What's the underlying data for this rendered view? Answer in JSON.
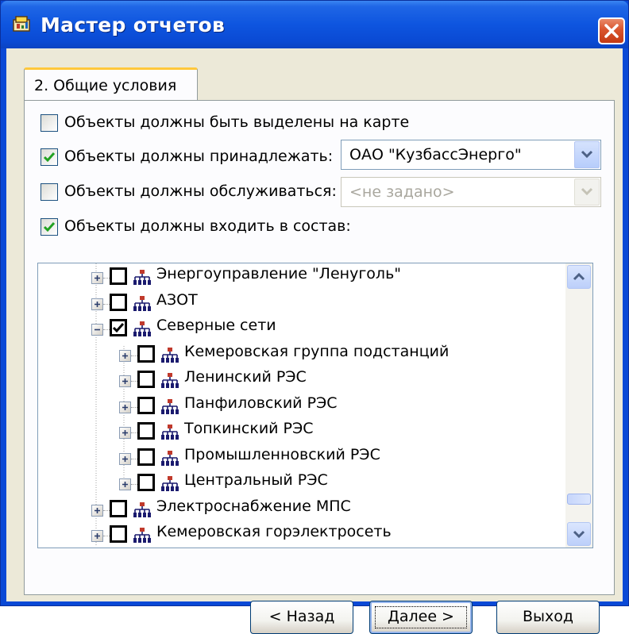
{
  "window": {
    "title": "Мастер отчетов"
  },
  "tab": {
    "label": "2. Общие условия"
  },
  "options": [
    {
      "label": "Объекты должны быть выделены на карте",
      "checked": false
    },
    {
      "label": "Объекты должны принадлежать:",
      "checked": true
    },
    {
      "label": "Объекты должны обслуживаться:",
      "checked": false
    },
    {
      "label": "Объекты должны входить в состав:",
      "checked": true
    }
  ],
  "owner_combo": {
    "value": "ОАО \"КузбассЭнерго\"",
    "enabled": true
  },
  "service_combo": {
    "value": "<не задано>",
    "enabled": false
  },
  "tree": {
    "items": [
      {
        "label": "Энергоуправление \"Ленуголь\"",
        "level": 0,
        "expanded": false,
        "checked": false
      },
      {
        "label": "АЗОТ",
        "level": 0,
        "expanded": false,
        "checked": false
      },
      {
        "label": "Северные сети",
        "level": 0,
        "expanded": true,
        "checked": true
      },
      {
        "label": "Кемеровская группа подстанций",
        "level": 1,
        "expanded": false,
        "checked": false
      },
      {
        "label": "Ленинский РЭС",
        "level": 1,
        "expanded": false,
        "checked": false
      },
      {
        "label": "Панфиловский РЭС",
        "level": 1,
        "expanded": false,
        "checked": false
      },
      {
        "label": "Топкинский РЭС",
        "level": 1,
        "expanded": false,
        "checked": false
      },
      {
        "label": "Промышленновский РЭС",
        "level": 1,
        "expanded": false,
        "checked": false
      },
      {
        "label": "Центральный РЭС",
        "level": 1,
        "expanded": false,
        "checked": false
      },
      {
        "label": "Электроснабжение МПС",
        "level": 0,
        "expanded": false,
        "checked": false
      },
      {
        "label": "Кемеровская горэлектросеть",
        "level": 0,
        "expanded": false,
        "checked": false
      }
    ]
  },
  "buttons": {
    "back": "< Назад",
    "next": "Далее >",
    "exit": "Выход"
  },
  "icons": {
    "app": "report-wizard-icon",
    "close": "close-icon",
    "node": "org-structure-icon"
  },
  "colors": {
    "titlebar": "#0a4ad4",
    "face": "#ece9d8",
    "check": "#21a121",
    "close": "#d9542d"
  }
}
